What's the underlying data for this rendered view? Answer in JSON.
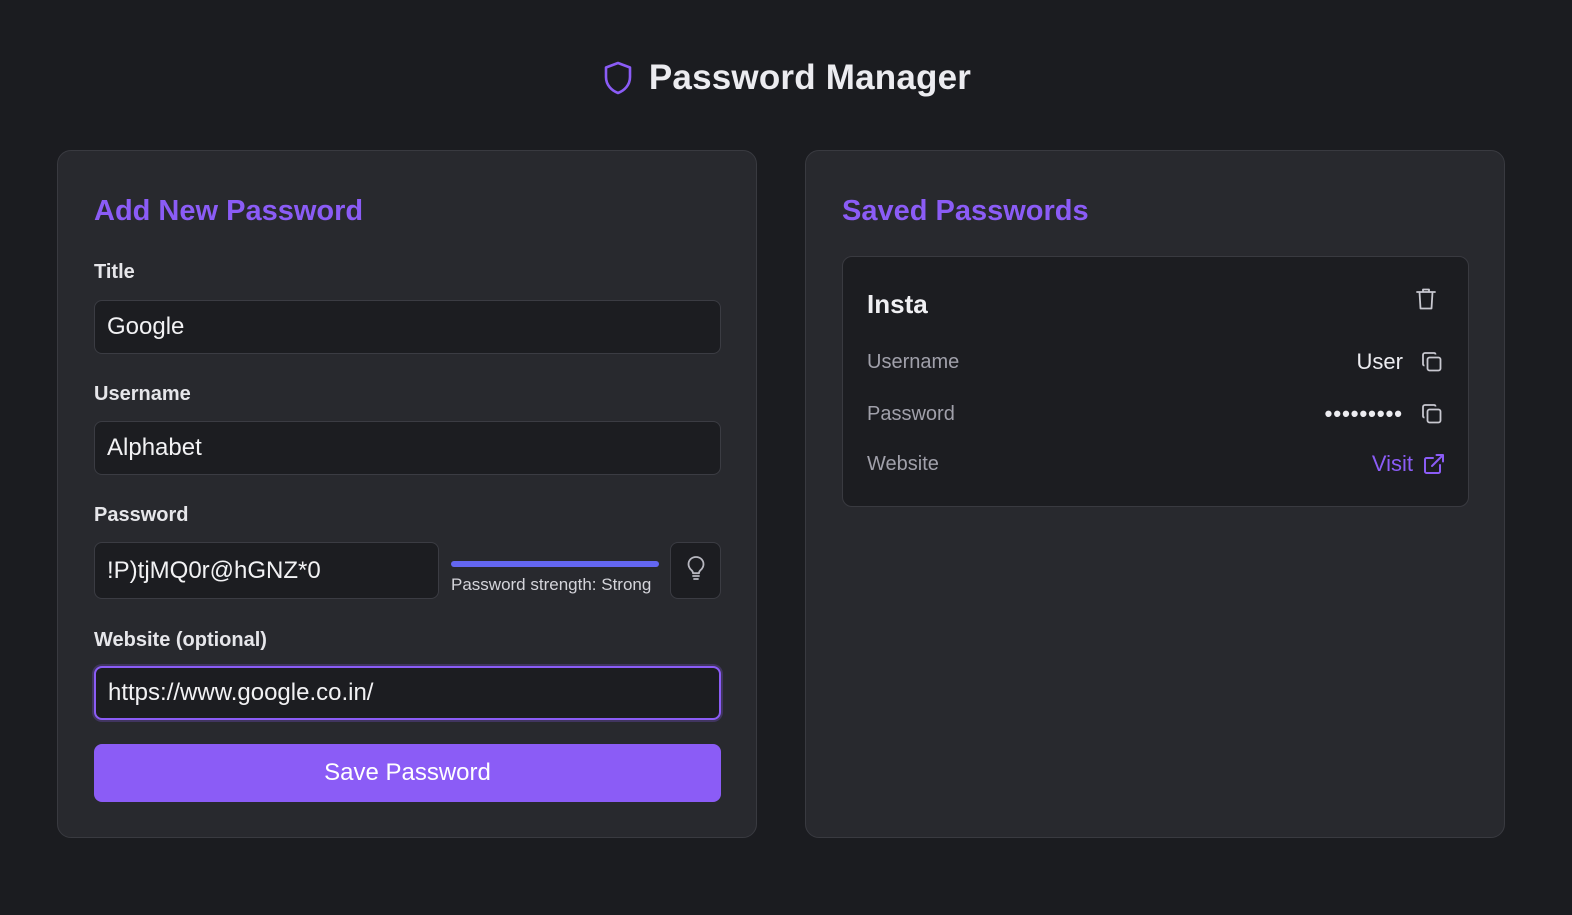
{
  "app": {
    "title": "Password Manager",
    "icon": "shield-icon",
    "accent_color": "#8b5cf6"
  },
  "add_form": {
    "heading": "Add New Password",
    "title_label": "Title",
    "title_value": "Google",
    "username_label": "Username",
    "username_value": "Alphabet",
    "password_label": "Password",
    "password_value": "!P)tjMQ0r@hGNZ*0",
    "strength_text": "Password strength: Strong",
    "strength_fraction": 1.0,
    "strength_color": "#6366f1",
    "generate_icon": "lightbulb-icon",
    "website_label": "Website (optional)",
    "website_value": "https://www.google.co.in/",
    "save_label": "Save Password"
  },
  "saved": {
    "heading": "Saved Passwords",
    "entries": [
      {
        "title": "Insta",
        "delete_icon": "trash-icon",
        "username_label": "Username",
        "username_value": "User",
        "password_label": "Password",
        "password_masked": "•••••••••",
        "website_label": "Website",
        "website_link_label": "Visit",
        "copy_icon": "copy-icon",
        "external_icon": "external-link-icon"
      }
    ]
  }
}
